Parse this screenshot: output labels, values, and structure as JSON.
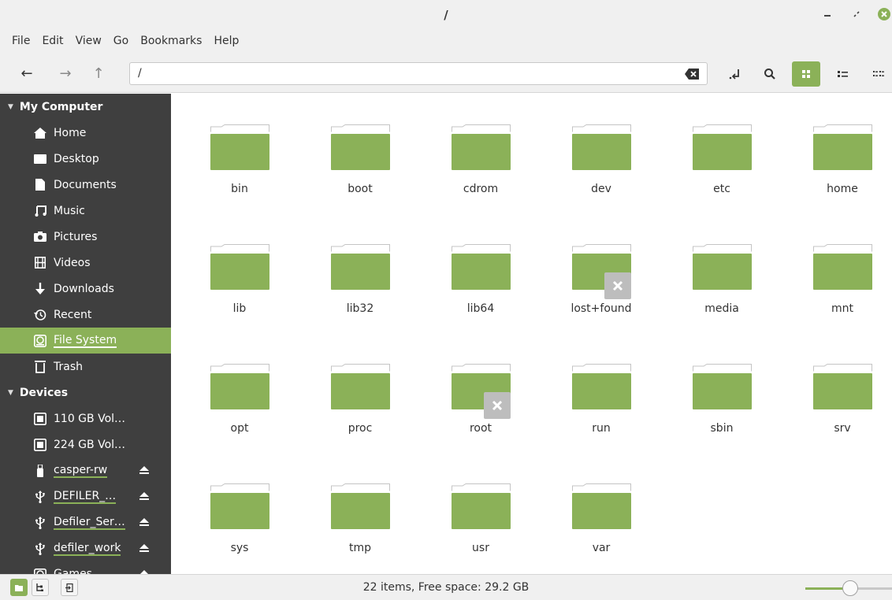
{
  "window": {
    "title": "/"
  },
  "menu": [
    "File",
    "Edit",
    "View",
    "Go",
    "Bookmarks",
    "Help"
  ],
  "toolbar": {
    "path_value": "/"
  },
  "sidebar": {
    "my_computer": {
      "header": "My Computer",
      "items": [
        {
          "label": "Home",
          "icon": "home-icon"
        },
        {
          "label": "Desktop",
          "icon": "desktop-icon"
        },
        {
          "label": "Documents",
          "icon": "documents-icon"
        },
        {
          "label": "Music",
          "icon": "music-icon"
        },
        {
          "label": "Pictures",
          "icon": "pictures-icon"
        },
        {
          "label": "Videos",
          "icon": "videos-icon"
        },
        {
          "label": "Downloads",
          "icon": "downloads-icon"
        },
        {
          "label": "Recent",
          "icon": "recent-icon"
        },
        {
          "label": "File System",
          "icon": "filesystem-icon",
          "selected": true
        },
        {
          "label": "Trash",
          "icon": "trash-icon"
        }
      ]
    },
    "devices": {
      "header": "Devices",
      "items": [
        {
          "label": "110 GB Vol…",
          "icon": "drive-icon"
        },
        {
          "label": "224 GB Vol…",
          "icon": "drive-icon"
        },
        {
          "label": "casper-rw",
          "icon": "usb-stick-icon"
        },
        {
          "label": "DEFILER_…",
          "icon": "usb-icon"
        },
        {
          "label": "Defiler_Ser…",
          "icon": "usb-icon"
        },
        {
          "label": "defiler_work",
          "icon": "usb-icon"
        },
        {
          "label": "Games",
          "icon": "disk-icon"
        }
      ]
    }
  },
  "files": [
    {
      "name": "bin"
    },
    {
      "name": "boot"
    },
    {
      "name": "cdrom"
    },
    {
      "name": "dev"
    },
    {
      "name": "etc"
    },
    {
      "name": "home"
    },
    {
      "name": "lib"
    },
    {
      "name": "lib32"
    },
    {
      "name": "lib64"
    },
    {
      "name": "lost+found",
      "locked": true
    },
    {
      "name": "media"
    },
    {
      "name": "mnt"
    },
    {
      "name": "opt"
    },
    {
      "name": "proc"
    },
    {
      "name": "root",
      "locked": true
    },
    {
      "name": "run"
    },
    {
      "name": "sbin"
    },
    {
      "name": "srv"
    },
    {
      "name": "sys"
    },
    {
      "name": "tmp"
    },
    {
      "name": "usr"
    },
    {
      "name": "var"
    }
  ],
  "statusbar": {
    "text": "22 items, Free space: 29.2 GB",
    "zoom_level": 0.52
  },
  "colors": {
    "accent": "#8bb158",
    "sidebar_bg": "#3f3f3f"
  }
}
